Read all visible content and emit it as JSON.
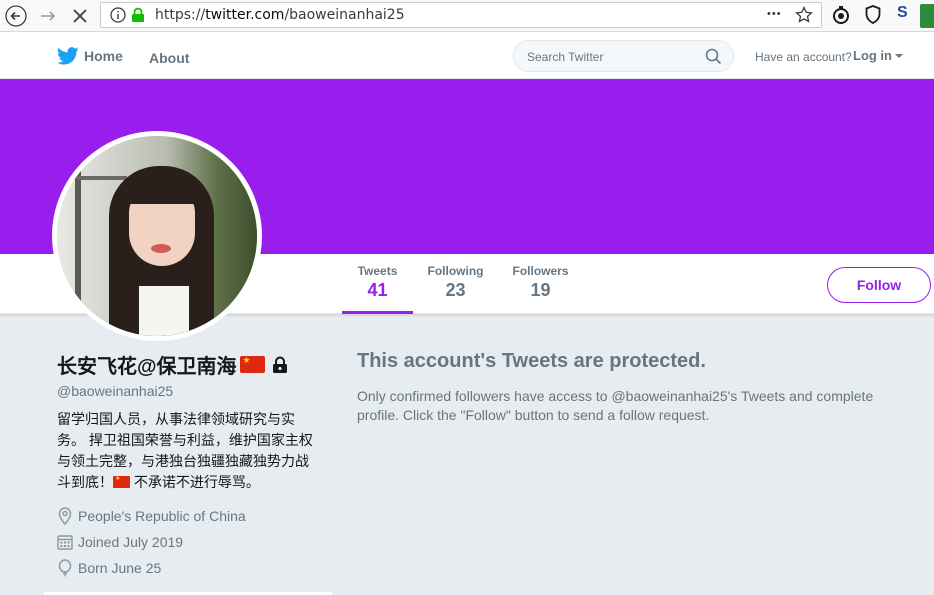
{
  "browser": {
    "url_prefix": "https://",
    "url_domain": "twitter.com",
    "url_path": "/baoweinanhai25",
    "menu_dots": "•••",
    "ext_s": "S"
  },
  "header": {
    "home_label": "Home",
    "about_label": "About",
    "search_placeholder": "Search Twitter",
    "have_account": "Have an account?",
    "login_label": "Log in"
  },
  "colors": {
    "accent": "#991ded",
    "twitter_blue": "#1da1f2",
    "muted": "#657786"
  },
  "stats": [
    {
      "label": "Tweets",
      "value": "41"
    },
    {
      "label": "Following",
      "value": "23"
    },
    {
      "label": "Followers",
      "value": "19"
    }
  ],
  "follow_label": "Follow",
  "profile": {
    "name": "长安飞花@保卫南海",
    "handle": "@baoweinanhai25",
    "bio_line1": "留学归国人员，从事法律领域研究与实务。 捍卫祖国荣誉与利益，维护国家主权与领土完整，与港独台独疆独藏独势力战斗到底！",
    "bio_line2": " 不承诺不进行辱骂。",
    "location": "People's Republic of China",
    "joined": "Joined July 2019",
    "born": "Born June 25"
  },
  "protected": {
    "title": "This account's Tweets are protected.",
    "message": "Only confirmed followers have access to @baoweinanhai25's Tweets and complete profile. Click the \"Follow\" button to send a follow request."
  }
}
